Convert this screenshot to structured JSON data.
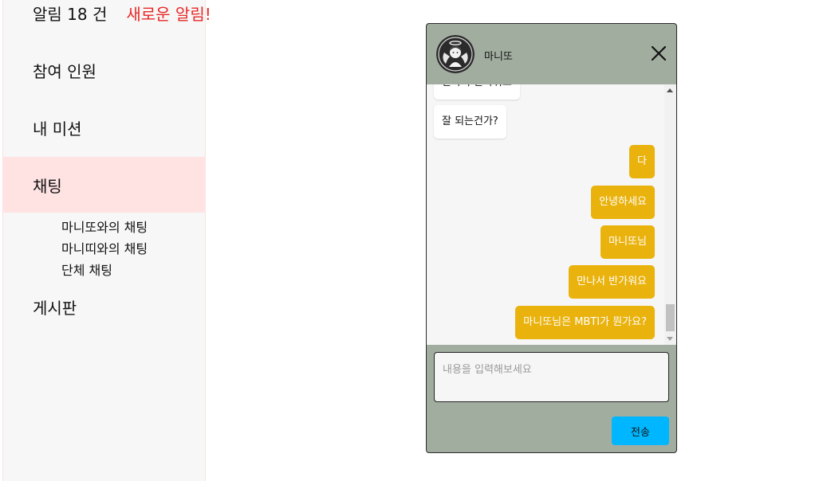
{
  "sidebar": {
    "notice_count": "알림 18 건",
    "notice_new": "새로운 알림!",
    "items": [
      {
        "label": "참여 인원"
      },
      {
        "label": "내 미션"
      },
      {
        "label": "채팅"
      },
      {
        "label": "게시판"
      }
    ],
    "chat_sub_items": [
      {
        "label": "마니또와의 채팅"
      },
      {
        "label": "마니띠와의 채팅"
      },
      {
        "label": "단체 채팅"
      }
    ]
  },
  "chat": {
    "title": "마니또",
    "messages": [
      {
        "side": "in",
        "text": "만나서 반가워요"
      },
      {
        "side": "in",
        "text": "잘 되는건가?"
      },
      {
        "side": "out",
        "text": "다"
      },
      {
        "side": "out",
        "text": "안녕하세요"
      },
      {
        "side": "out",
        "text": "마니또님"
      },
      {
        "side": "out",
        "text": "만나서 반가워요"
      },
      {
        "side": "out",
        "text": "마니또님은 MBTI가 뭔가요?"
      }
    ],
    "input_placeholder": "내용을 입력해보세요",
    "send_label": "전송"
  },
  "colors": {
    "chat_frame": "#a1ad9f",
    "outgoing_bubble": "#eab20c",
    "send_button": "#00b7ff",
    "alert_text": "#e82828",
    "active_menu": "#ffe3e3"
  },
  "icons": {
    "avatar": "angel-avatar-icon",
    "close": "close-icon"
  }
}
